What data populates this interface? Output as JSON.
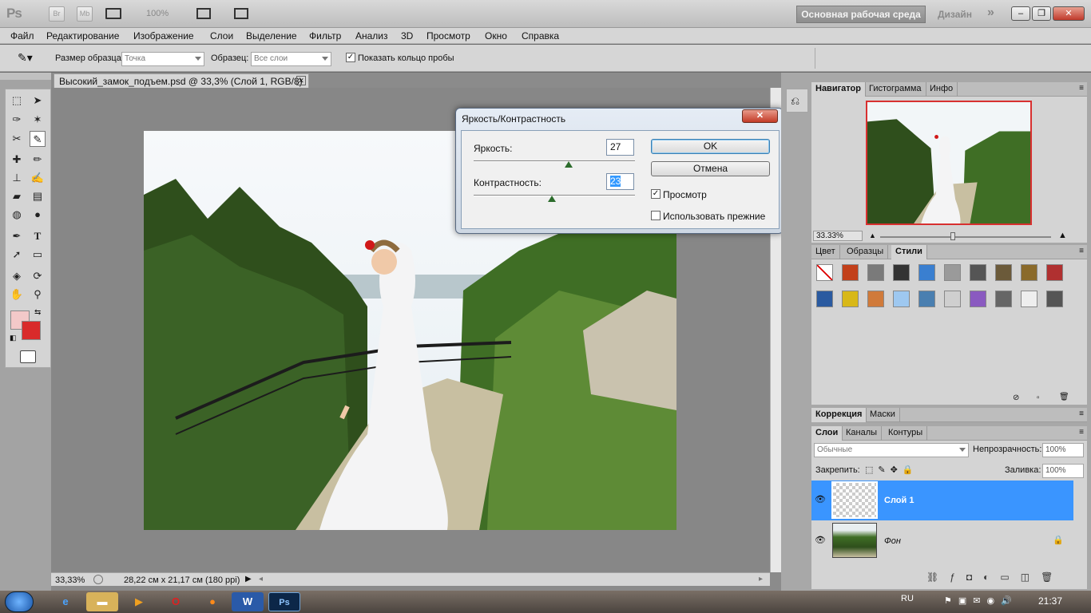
{
  "app": {
    "logo": "Ps",
    "bridge_btn": "Br",
    "minibridge_btn": "Mb",
    "zoom_display": "100%",
    "workspace": "Основная рабочая среда",
    "workspace_design": "Дизайн",
    "more_glyph": "»"
  },
  "menu": [
    "Файл",
    "Редактирование",
    "Изображение",
    "Слои",
    "Выделение",
    "Фильтр",
    "Анализ",
    "3D",
    "Просмотр",
    "Окно",
    "Справка"
  ],
  "options": {
    "sample_size_label": "Размер образца:",
    "sample_size_value": "Точка",
    "sample_label": "Образец:",
    "sample_value": "Все слои",
    "show_ring_label": "Показать кольцо пробы",
    "show_ring_checked": "✓"
  },
  "document": {
    "tab_title": "Высокий_замок_подъем.psd @ 33,3% (Слой 1, RGB/8)",
    "status_zoom": "33,33%",
    "status_info": "28,22 см x 21,17 см (180 ppi)"
  },
  "dialog": {
    "title": "Яркость/Контрастность",
    "brightness_label": "Яркость:",
    "brightness_value": "27",
    "brightness_level": 27,
    "contrast_label": "Контрастность:",
    "contrast_value": "23",
    "contrast_level": 23,
    "ok": "OK",
    "cancel": "Отмена",
    "preview_label": "Просмотр",
    "preview_check": "✓",
    "legacy_label": "Использовать прежние"
  },
  "navigator": {
    "tabs": [
      "Навигатор",
      "Гистограмма",
      "Инфо"
    ],
    "zoom": "33.33%"
  },
  "styles_panel": {
    "tabs": [
      "Цвет",
      "Образцы",
      "Стили"
    ]
  },
  "correction_panel": {
    "tabs": [
      "Коррекция",
      "Маски"
    ]
  },
  "layers": {
    "tabs": [
      "Слои",
      "Каналы",
      "Контуры"
    ],
    "blend_mode": "Обычные",
    "opacity_label": "Непрозрачность:",
    "opacity_value": "100%",
    "lock_label": "Закрепить:",
    "fill_label": "Заливка:",
    "fill_value": "100%",
    "items": [
      {
        "name": "Слой 1"
      },
      {
        "name": "Фон"
      }
    ]
  },
  "taskbar": {
    "lang": "RU",
    "time": "21:37",
    "photoshop_label": "Ps",
    "word_label": "W"
  },
  "colors": {
    "foreground": "#f3c9c9",
    "background": "#d92a2a",
    "selection": "#3a95ff"
  }
}
